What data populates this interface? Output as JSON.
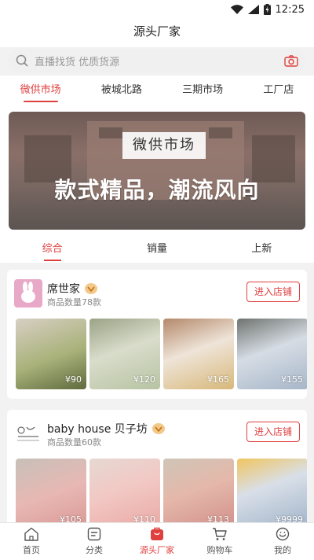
{
  "status": {
    "time": "12:25"
  },
  "header": {
    "title": "源头厂家"
  },
  "search": {
    "placeholder": "直播找货 优质货源"
  },
  "top_tabs": [
    {
      "label": "微供市场",
      "active": true
    },
    {
      "label": "被城北路",
      "active": false
    },
    {
      "label": "三期市场",
      "active": false
    },
    {
      "label": "工厂店",
      "active": false
    }
  ],
  "banner": {
    "sign": "微供市场",
    "slogan": "款式精品，潮流风向"
  },
  "sort_tabs": [
    {
      "label": "综合",
      "active": true
    },
    {
      "label": "销量",
      "active": false
    },
    {
      "label": "上新",
      "active": false
    }
  ],
  "shops": [
    {
      "name": "席世家",
      "count": "商品数量78款",
      "enter_label": "进入店铺",
      "products": [
        {
          "price": "¥90"
        },
        {
          "price": "¥120"
        },
        {
          "price": "¥165"
        },
        {
          "price": "¥155"
        }
      ]
    },
    {
      "name": "baby house 贝子坊",
      "count": "商品数量60款",
      "enter_label": "进入店铺",
      "products": [
        {
          "price": "¥105"
        },
        {
          "price": "¥110"
        },
        {
          "price": "¥113"
        },
        {
          "price": "¥9999"
        }
      ]
    }
  ],
  "tabbar": [
    {
      "label": "首页",
      "icon": "home-icon",
      "active": false
    },
    {
      "label": "分类",
      "icon": "category-icon",
      "active": false
    },
    {
      "label": "源头厂家",
      "icon": "factory-icon",
      "active": true
    },
    {
      "label": "购物车",
      "icon": "cart-icon",
      "active": false
    },
    {
      "label": "我的",
      "icon": "profile-icon",
      "active": false
    }
  ],
  "colors": {
    "accent": "#e03f3f"
  }
}
